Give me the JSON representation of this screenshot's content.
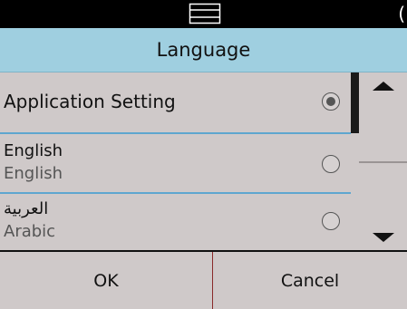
{
  "status_bar": {
    "icon": "scanner-tray-icon",
    "clipped_text": "("
  },
  "header": {
    "title": "Language"
  },
  "language_list": {
    "items": [
      {
        "primary": "Application Setting",
        "secondary": "",
        "selected": true
      },
      {
        "primary": "English",
        "secondary": "English",
        "selected": false
      },
      {
        "primary": "العربية",
        "secondary": "Arabic",
        "selected": false
      }
    ]
  },
  "scrollbar": {
    "up_icon": "triangle-up-icon",
    "down_icon": "triangle-down-icon"
  },
  "buttons": {
    "ok_label": "OK",
    "cancel_label": "Cancel"
  },
  "colors": {
    "title_bar": "#9fcfe0",
    "list_background": "#cfc9c9",
    "separator": "#5ea6cf",
    "status_bar": "#000000"
  }
}
